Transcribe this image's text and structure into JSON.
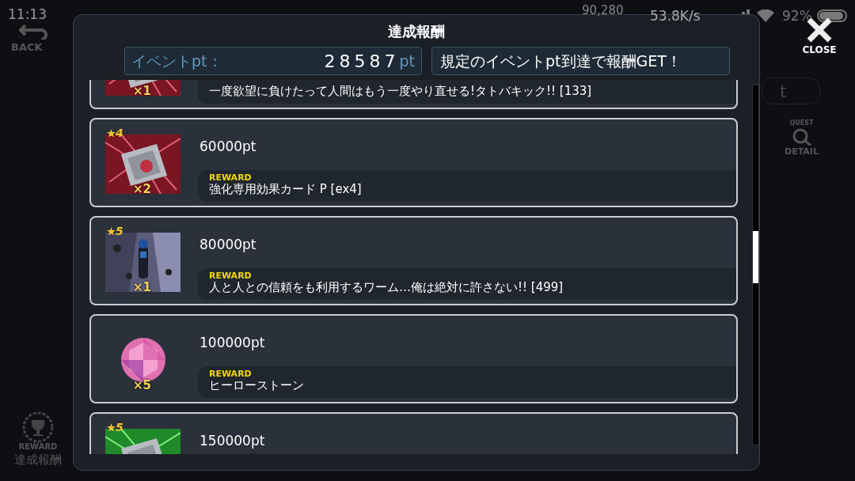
{
  "status_bar": {
    "time": "11:13",
    "speed": "53.8K/s",
    "battery": "92%"
  },
  "background": {
    "back_label": "BACK",
    "currency": "90,280",
    "side_text": "t",
    "quest_label": "QUEST",
    "detail_label": "DETAIL",
    "reward_label": "REWARD",
    "reward_title": "達成報酬"
  },
  "dialog": {
    "title": "達成報酬",
    "close_label": "CLOSE",
    "points_label": "イベントpt：",
    "points_value": "28587",
    "points_unit": "pt",
    "notice": "規定のイベントpt到達で報酬GET！"
  },
  "rewards": [
    {
      "kind": "card_red",
      "count": "×1",
      "reward": "一度欲望に負けたって人間はもう一度やり直せる!タトバキック!! [133]"
    },
    {
      "kind": "card_red",
      "rarity": "4",
      "count": "×2",
      "points": "60000pt",
      "reward_label": "REWARD",
      "reward": "強化専用効果カード P [ex4]"
    },
    {
      "kind": "figure",
      "rarity": "5",
      "count": "×1",
      "points": "80000pt",
      "reward_label": "REWARD",
      "reward": "人と人との信頼をも利用するワーム…俺は絶対に許さない!! [499]"
    },
    {
      "kind": "gem",
      "count": "×5",
      "points": "100000pt",
      "reward_label": "REWARD",
      "reward": "ヒーローストーン"
    },
    {
      "kind": "card_green",
      "rarity": "5",
      "points": "150000pt"
    }
  ]
}
